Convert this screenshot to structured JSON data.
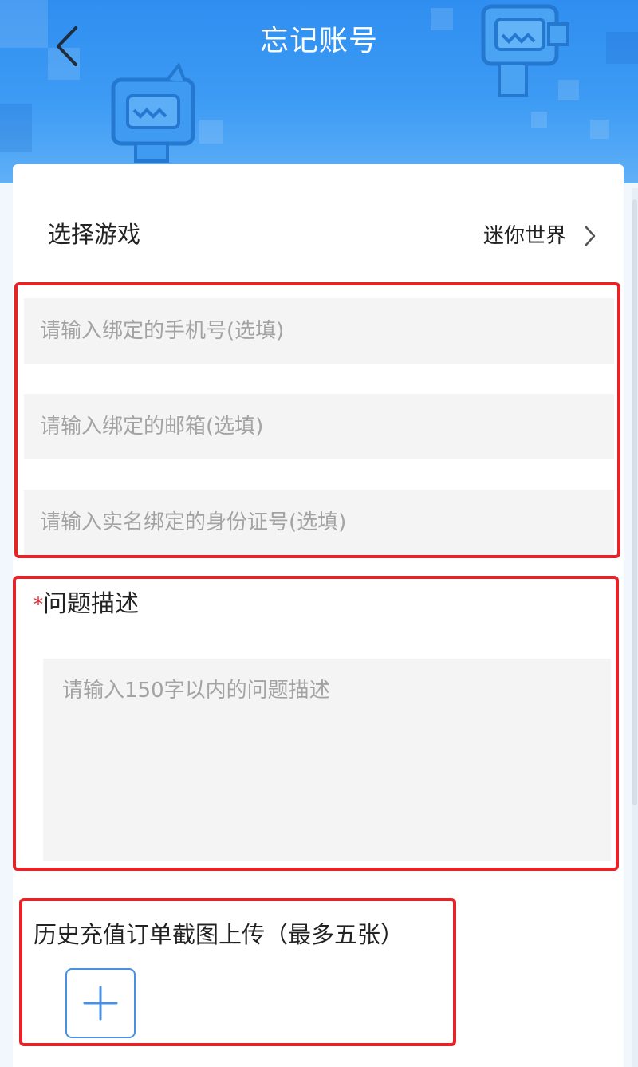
{
  "header": {
    "title": "忘记账号",
    "back_icon": "chevron-left-icon"
  },
  "game_select": {
    "label": "选择游戏",
    "value": "迷你世界",
    "chevron_icon": "chevron-right-icon"
  },
  "optional_fields": {
    "phone_placeholder": "请输入绑定的手机号(选填)",
    "email_placeholder": "请输入绑定的邮箱(选填)",
    "id_placeholder": "请输入实名绑定的身份证号(选填)"
  },
  "description": {
    "required_mark": "*",
    "label": "问题描述",
    "placeholder": "请输入150字以内的问题描述"
  },
  "upload": {
    "label": "历史充值订单截图上传（最多五张）",
    "add_icon": "plus-icon"
  },
  "colors": {
    "header_blue": "#2f8ef0",
    "highlight_red": "#e5242a",
    "upload_blue": "#4a90e2"
  }
}
